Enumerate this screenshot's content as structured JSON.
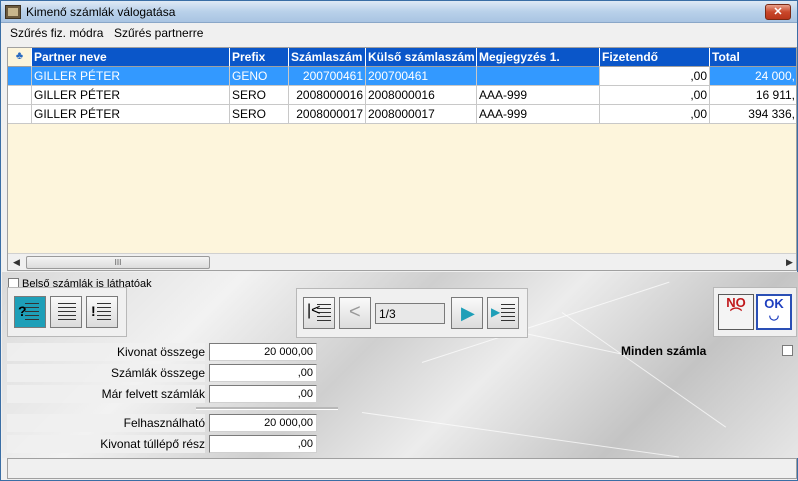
{
  "window": {
    "title": "Kimenő számlák válogatása",
    "close_label": "✕"
  },
  "menu": [
    "Szűrés fiz. módra",
    "Szűrés partnerre"
  ],
  "grid": {
    "corner_icon": "♣",
    "columns": [
      "Partner neve",
      "Prefix",
      "Számlaszám",
      "Külső számlaszám",
      "Megjegyzés 1.",
      "Fizetendő",
      "Total"
    ],
    "rows": [
      {
        "partner": "GILLER PÉTER",
        "prefix": "GENO",
        "szamlaszam": "200700461",
        "kulso": "200700461",
        "megjegyzes": "",
        "fizetendo": ",00",
        "total": "24 000,"
      },
      {
        "partner": "GILLER PÉTER",
        "prefix": "SERO",
        "szamlaszam": "2008000016",
        "kulso": "2008000016",
        "megjegyzes": "AAA-999",
        "fizetendo": ",00",
        "total": "16 911,"
      },
      {
        "partner": "GILLER PÉTER",
        "prefix": "SERO",
        "szamlaszam": "2008000017",
        "kulso": "2008000017",
        "megjegyzes": "AAA-999",
        "fizetendo": ",00",
        "total": "394 336,"
      }
    ],
    "scroll_thumb_label": "III"
  },
  "checkbox_internal": {
    "label": "Belső számlák is láthatóak",
    "checked": false
  },
  "navigator": {
    "position": "1/3"
  },
  "face_buttons": {
    "no_label": "NO",
    "ok_label": "OK"
  },
  "all_invoices": {
    "label": "Minden számla",
    "checked": false
  },
  "form": {
    "kivonat_osszege": {
      "label": "Kivonat összege",
      "value": "20 000,00"
    },
    "szamlak_osszege": {
      "label": "Számlák összege",
      "value": ",00"
    },
    "mar_felvett": {
      "label": "Már felvett számlák",
      "value": ",00"
    },
    "felhasznalhato": {
      "label": "Felhasználható",
      "value": "20 000,00"
    },
    "tullepo": {
      "label": "Kivonat túllépő rész",
      "value": ",00"
    }
  },
  "colors": {
    "header_blue": "#0a56c9",
    "selection": "#3399ff",
    "grid_bg": "#fdf5dc"
  }
}
